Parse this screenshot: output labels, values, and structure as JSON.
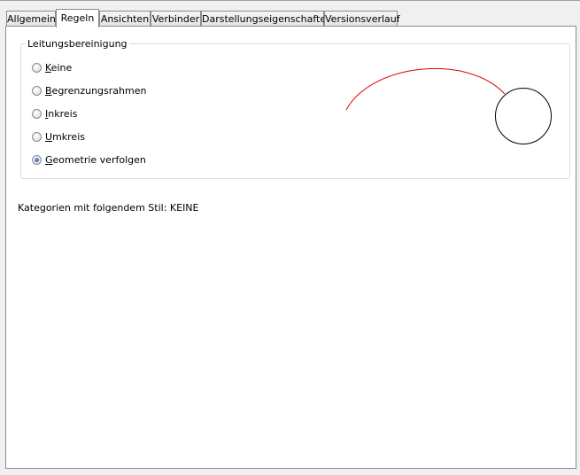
{
  "tabs": [
    {
      "label": "Allgemein",
      "active": false
    },
    {
      "label": "Regeln",
      "active": true
    },
    {
      "label": "Ansichten",
      "active": false
    },
    {
      "label": "Verbinder",
      "active": false
    },
    {
      "label": "Darstellungseigenschaften",
      "active": false
    },
    {
      "label": "Versionsverlauf",
      "active": false
    }
  ],
  "group": {
    "title": "Leitungsbereinigung",
    "options": [
      {
        "mnemonic": "K",
        "rest": "eine",
        "checked": false
      },
      {
        "mnemonic": "B",
        "rest": "egrenzungsrahmen",
        "checked": false
      },
      {
        "mnemonic": "I",
        "rest": "nkreis",
        "checked": false
      },
      {
        "mnemonic": "U",
        "rest": "mkreis",
        "checked": false
      },
      {
        "mnemonic": "G",
        "rest": "eometrie verfolgen",
        "checked": true
      }
    ]
  },
  "preview": {
    "line_color": "#e00000",
    "shape_color": "#000000",
    "shape": "circle"
  },
  "info_text": "Kategorien mit folgendem Stil: KEINE"
}
